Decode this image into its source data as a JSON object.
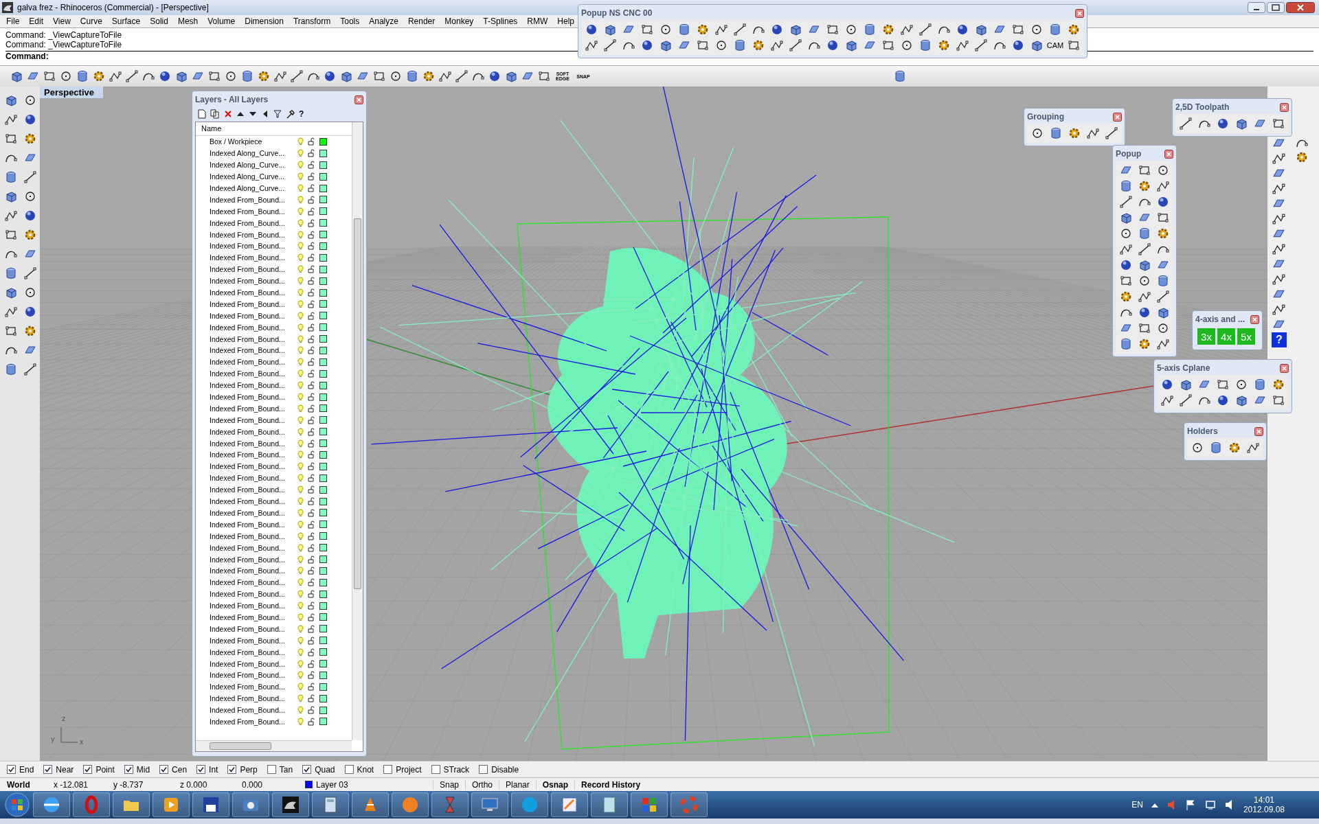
{
  "window": {
    "title": "galva frez - Rhinoceros (Commercial) - [Perspective]"
  },
  "menu": [
    "File",
    "Edit",
    "View",
    "Curve",
    "Surface",
    "Solid",
    "Mesh",
    "Volume",
    "Dimension",
    "Transform",
    "Tools",
    "Analyze",
    "Render",
    "Monkey",
    "T-Splines",
    "RMW",
    "Help"
  ],
  "command_history": [
    "Command: _ViewCaptureToFile",
    "Command: _ViewCaptureToFile"
  ],
  "command_prompt": {
    "label": "Command:"
  },
  "toolbar": {
    "text_buttons": [
      "SOFT EDGE",
      "SNAP"
    ]
  },
  "viewport": {
    "title": "Perspective",
    "axis_labels": [
      "z",
      "y",
      "x"
    ]
  },
  "layers_panel": {
    "title": "Layers - All Layers",
    "help": "?",
    "column": "Name",
    "layers": [
      {
        "name": "Box / Workpiece",
        "color": "#00ff00"
      },
      {
        "name": "Indexed Along_Curve...",
        "color": "#80ffc0"
      },
      {
        "name": "Indexed Along_Curve...",
        "color": "#80ffc0"
      },
      {
        "name": "Indexed Along_Curve...",
        "color": "#80ffc0"
      },
      {
        "name": "Indexed Along_Curve...",
        "color": "#80ffc0"
      },
      {
        "name": "Indexed From_Bound...",
        "color": "#80ffc0"
      },
      {
        "name": "Indexed From_Bound...",
        "color": "#80ffc0"
      },
      {
        "name": "Indexed From_Bound...",
        "color": "#80ffc0"
      },
      {
        "name": "Indexed From_Bound...",
        "color": "#80ffc0"
      },
      {
        "name": "Indexed From_Bound...",
        "color": "#80ffc0"
      },
      {
        "name": "Indexed From_Bound...",
        "color": "#80ffc0"
      },
      {
        "name": "Indexed From_Bound...",
        "color": "#80ffc0"
      },
      {
        "name": "Indexed From_Bound...",
        "color": "#80ffc0"
      },
      {
        "name": "Indexed From_Bound...",
        "color": "#80ffc0"
      },
      {
        "name": "Indexed From_Bound...",
        "color": "#80ffc0"
      },
      {
        "name": "Indexed From_Bound...",
        "color": "#80ffc0"
      },
      {
        "name": "Indexed From_Bound...",
        "color": "#80ffc0"
      },
      {
        "name": "Indexed From_Bound...",
        "color": "#80ffc0"
      },
      {
        "name": "Indexed From_Bound...",
        "color": "#80ffc0"
      },
      {
        "name": "Indexed From_Bound...",
        "color": "#80ffc0"
      },
      {
        "name": "Indexed From_Bound...",
        "color": "#80ffc0"
      },
      {
        "name": "Indexed From_Bound...",
        "color": "#80ffc0"
      },
      {
        "name": "Indexed From_Bound...",
        "color": "#80ffc0"
      },
      {
        "name": "Indexed From_Bound...",
        "color": "#80ffc0"
      },
      {
        "name": "Indexed From_Bound...",
        "color": "#80ffc0"
      },
      {
        "name": "Indexed From_Bound...",
        "color": "#80ffc0"
      },
      {
        "name": "Indexed From_Bound...",
        "color": "#80ffc0"
      },
      {
        "name": "Indexed From_Bound...",
        "color": "#80ffc0"
      },
      {
        "name": "Indexed From_Bound...",
        "color": "#80ffc0"
      },
      {
        "name": "Indexed From_Bound...",
        "color": "#80ffc0"
      },
      {
        "name": "Indexed From_Bound...",
        "color": "#80ffc0"
      },
      {
        "name": "Indexed From_Bound...",
        "color": "#80ffc0"
      },
      {
        "name": "Indexed From_Bound...",
        "color": "#80ffc0"
      },
      {
        "name": "Indexed From_Bound...",
        "color": "#80ffc0"
      },
      {
        "name": "Indexed From_Bound...",
        "color": "#80ffc0"
      },
      {
        "name": "Indexed From_Bound...",
        "color": "#80ffc0"
      },
      {
        "name": "Indexed From_Bound...",
        "color": "#80ffc0"
      },
      {
        "name": "Indexed From_Bound...",
        "color": "#80ffc0"
      },
      {
        "name": "Indexed From_Bound...",
        "color": "#80ffc0"
      },
      {
        "name": "Indexed From_Bound...",
        "color": "#80ffc0"
      },
      {
        "name": "Indexed From_Bound...",
        "color": "#80ffc0"
      },
      {
        "name": "Indexed From_Bound...",
        "color": "#80ffc0"
      },
      {
        "name": "Indexed From_Bound...",
        "color": "#80ffc0"
      },
      {
        "name": "Indexed From_Bound...",
        "color": "#80ffc0"
      },
      {
        "name": "Indexed From_Bound...",
        "color": "#80ffc0"
      },
      {
        "name": "Indexed From_Bound...",
        "color": "#80ffc0"
      },
      {
        "name": "Indexed From_Bound...",
        "color": "#80ffc0"
      },
      {
        "name": "Indexed From_Bound...",
        "color": "#80ffc0"
      },
      {
        "name": "Indexed From_Bound...",
        "color": "#80ffc0"
      },
      {
        "name": "Indexed From_Bound...",
        "color": "#80ffc0"
      },
      {
        "name": "Indexed From_Bound...",
        "color": "#80ffc0"
      }
    ]
  },
  "floating_panels": [
    {
      "title": "Popup NS CNC 00",
      "labels": [
        "CAM"
      ]
    },
    {
      "title": "Grouping"
    },
    {
      "title": "2,5D Toolpath"
    },
    {
      "title": "Popup"
    },
    {
      "title": "4-axis and ...",
      "buttons": [
        "3x",
        "4x",
        "5x"
      ]
    },
    {
      "title": "5-axis Cplane"
    },
    {
      "title": "Holders"
    }
  ],
  "right_toolbar": {
    "help": "?"
  },
  "osnaps": [
    {
      "label": "End",
      "checked": true
    },
    {
      "label": "Near",
      "checked": true
    },
    {
      "label": "Point",
      "checked": true
    },
    {
      "label": "Mid",
      "checked": true
    },
    {
      "label": "Cen",
      "checked": true
    },
    {
      "label": "Int",
      "checked": true
    },
    {
      "label": "Perp",
      "checked": true
    },
    {
      "label": "Tan",
      "checked": false
    },
    {
      "label": "Quad",
      "checked": true
    },
    {
      "label": "Knot",
      "checked": false
    },
    {
      "label": "Project",
      "checked": false
    },
    {
      "label": "STrack",
      "checked": false
    },
    {
      "label": "Disable",
      "checked": false
    }
  ],
  "status_bar": {
    "cplane": "World",
    "x": "x -12.081",
    "y": "y -8.737",
    "z": "z 0.000",
    "distance": "0.000",
    "layer": {
      "name": "Layer 03",
      "color": "#0000ff"
    },
    "toggles": [
      {
        "label": "Snap",
        "on": false
      },
      {
        "label": "Ortho",
        "on": false
      },
      {
        "label": "Planar",
        "on": false
      },
      {
        "label": "Osnap",
        "on": true
      },
      {
        "label": "Record History",
        "on": true
      }
    ]
  },
  "taskbar": {
    "language": "EN",
    "time": "14:01",
    "date": "2012.09.08"
  }
}
